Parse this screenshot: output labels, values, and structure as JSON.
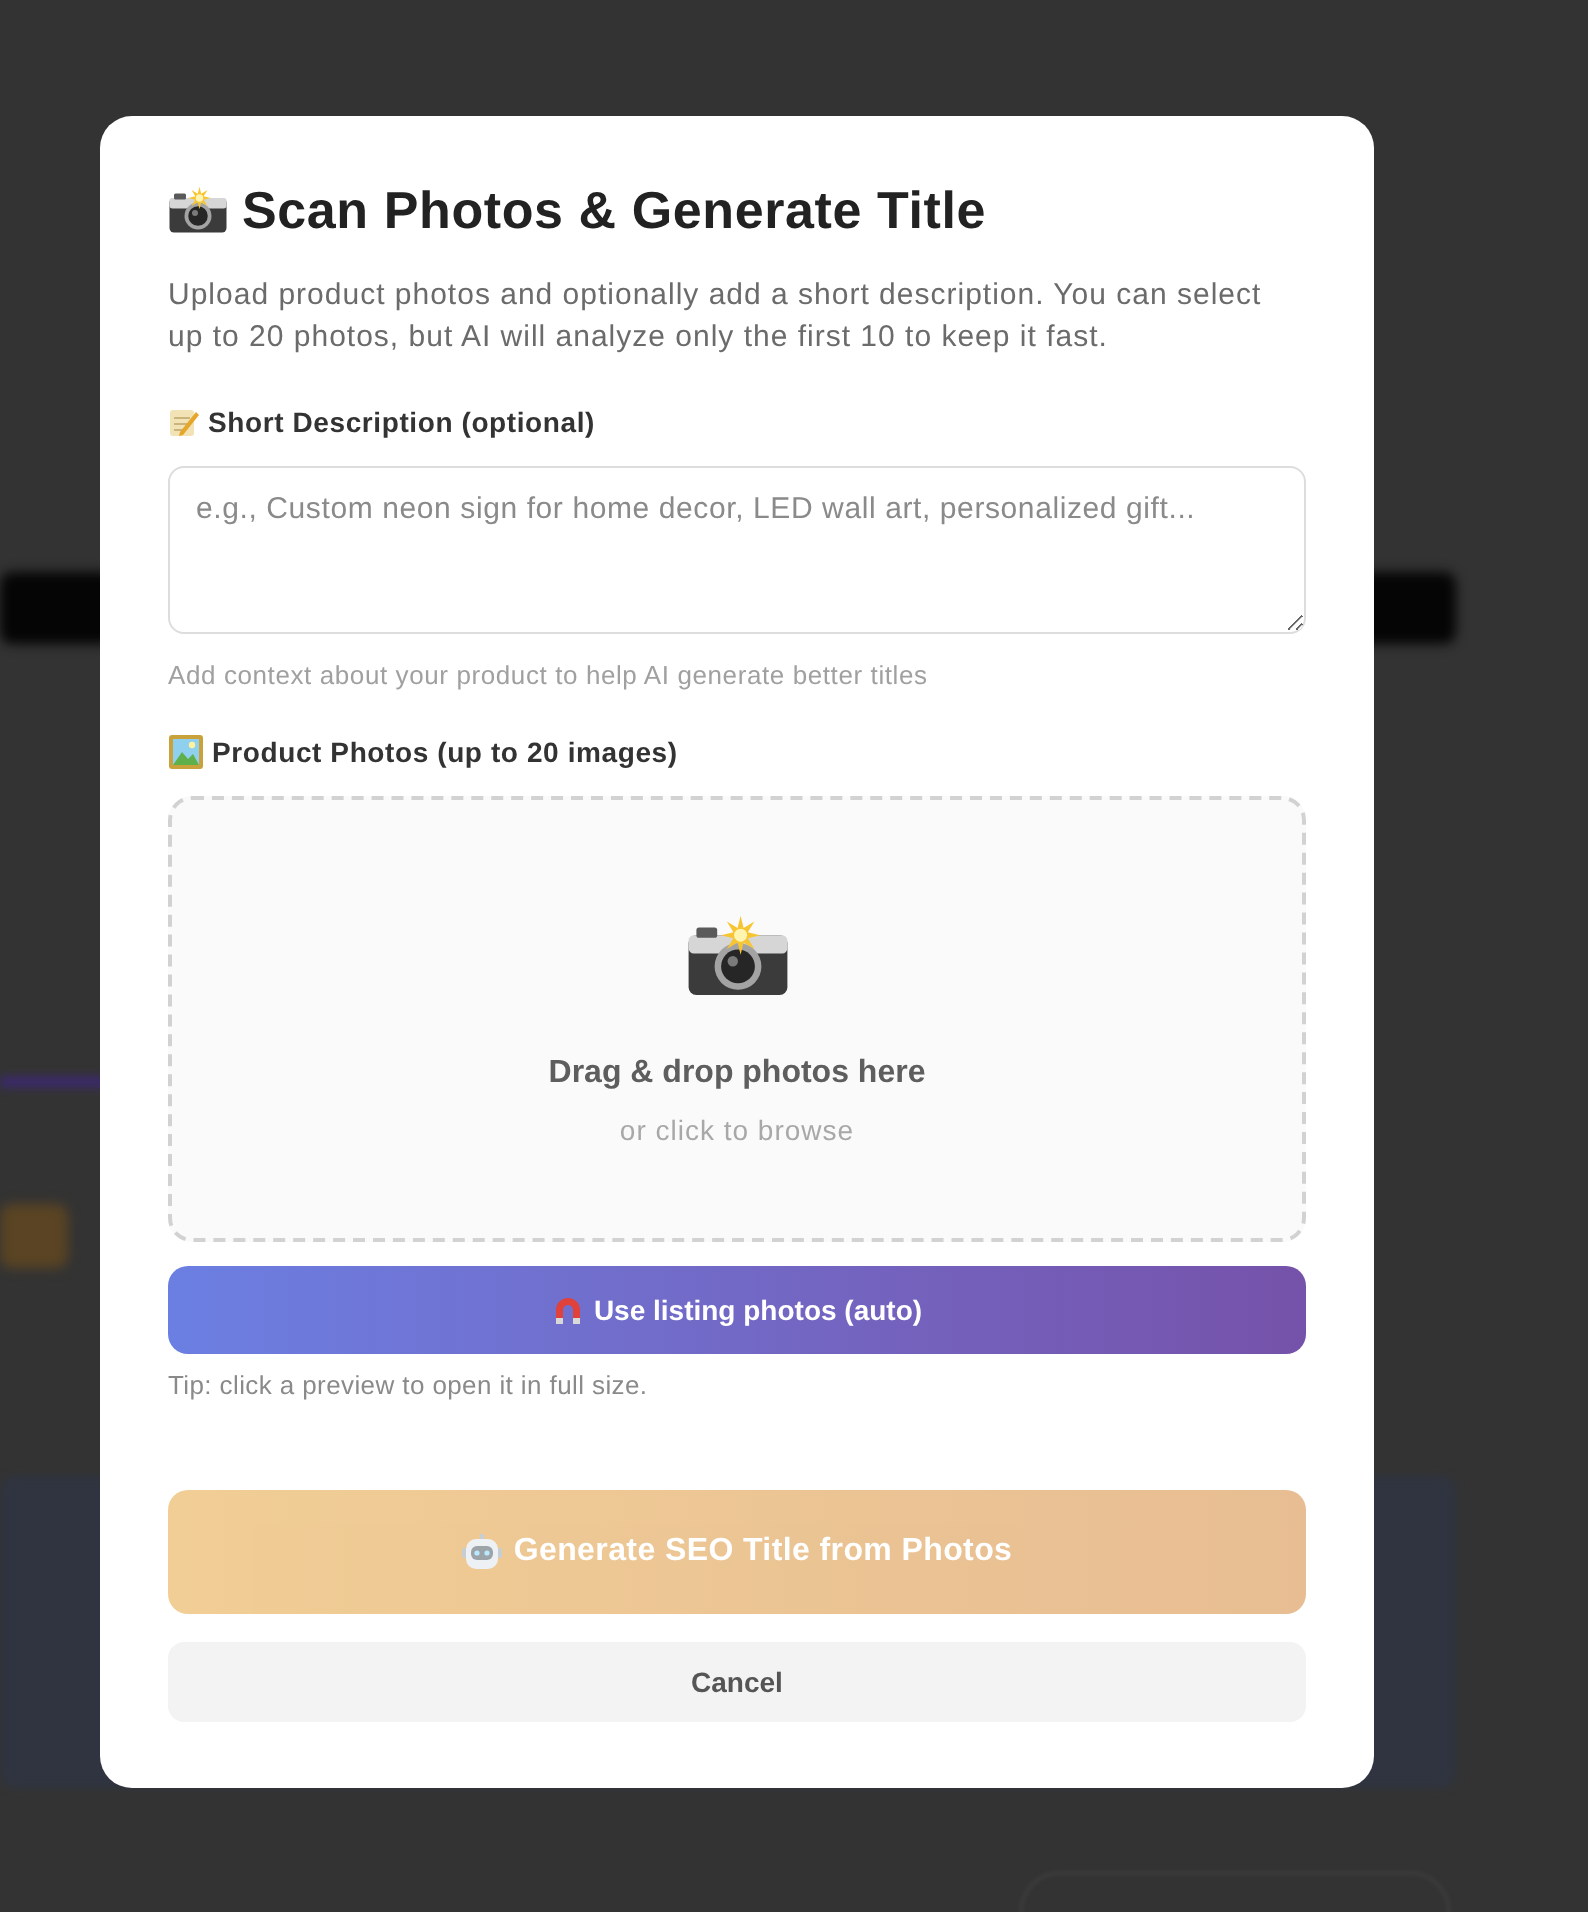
{
  "modal": {
    "title": "Scan Photos & Generate Title",
    "intro": "Upload product photos and optionally add a short description. You can select up to 20 photos, but AI will analyze only the first 10 to keep it fast.",
    "description_field": {
      "label": "Short Description (optional)",
      "placeholder": "e.g., Custom neon sign for home decor, LED wall art, personalized gift...",
      "hint": "Add context about your product to help AI generate better titles"
    },
    "photos": {
      "label": "Product Photos (up to 20 images)",
      "drop_zone": {
        "title": "Drag & drop photos here",
        "subtitle": "or click to browse"
      },
      "listing_button": {
        "label": "Use listing photos (auto)"
      },
      "tip": "Tip: click a preview to open it in full size."
    },
    "buttons": [
      {
        "kind": "primary",
        "label": "Generate SEO Title from Photos",
        "disabled": true
      },
      {
        "kind": "secondary",
        "label": "Cancel",
        "disabled": false
      }
    ]
  }
}
